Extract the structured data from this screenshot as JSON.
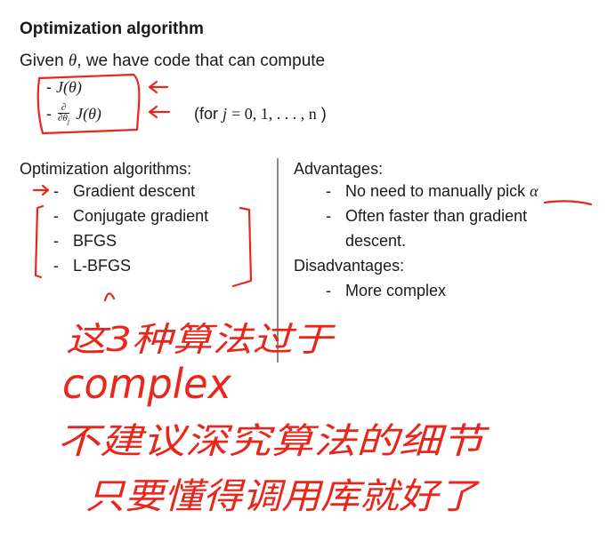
{
  "slide": {
    "title": "Optimization algorithm",
    "given": {
      "prefix": "Given",
      "theta": "θ",
      "suffix": ", we have code that can compute"
    },
    "formulas": {
      "f1": {
        "dash": "-",
        "expr": "J(θ)"
      },
      "f2": {
        "dash": "-",
        "num": "∂",
        "den": "∂θ",
        "sub": "j",
        "expr": "J(θ)"
      },
      "for": {
        "open": "(for",
        "j": "j",
        "eq": "= 0, 1, . . . , n",
        "close": ")"
      }
    },
    "left": {
      "heading": "Optimization algorithms:",
      "items": [
        "Gradient descent",
        "Conjugate gradient",
        "BFGS",
        "L-BFGS"
      ]
    },
    "right": {
      "advantages_heading": "Advantages:",
      "adv1_prefix": "No need to manually pick",
      "adv1_alpha": "α",
      "adv2_line1": "Often faster than gradient",
      "adv2_line2": "descent.",
      "disadvantages_heading": "Disadvantages:",
      "dis1": "More complex"
    }
  },
  "annotation": {
    "color": "#e8261c",
    "line1": "这3种算法过于",
    "line2": "complex",
    "line3": "不建议深究算法的细节",
    "line4": "只要懂得调用库就好了"
  }
}
